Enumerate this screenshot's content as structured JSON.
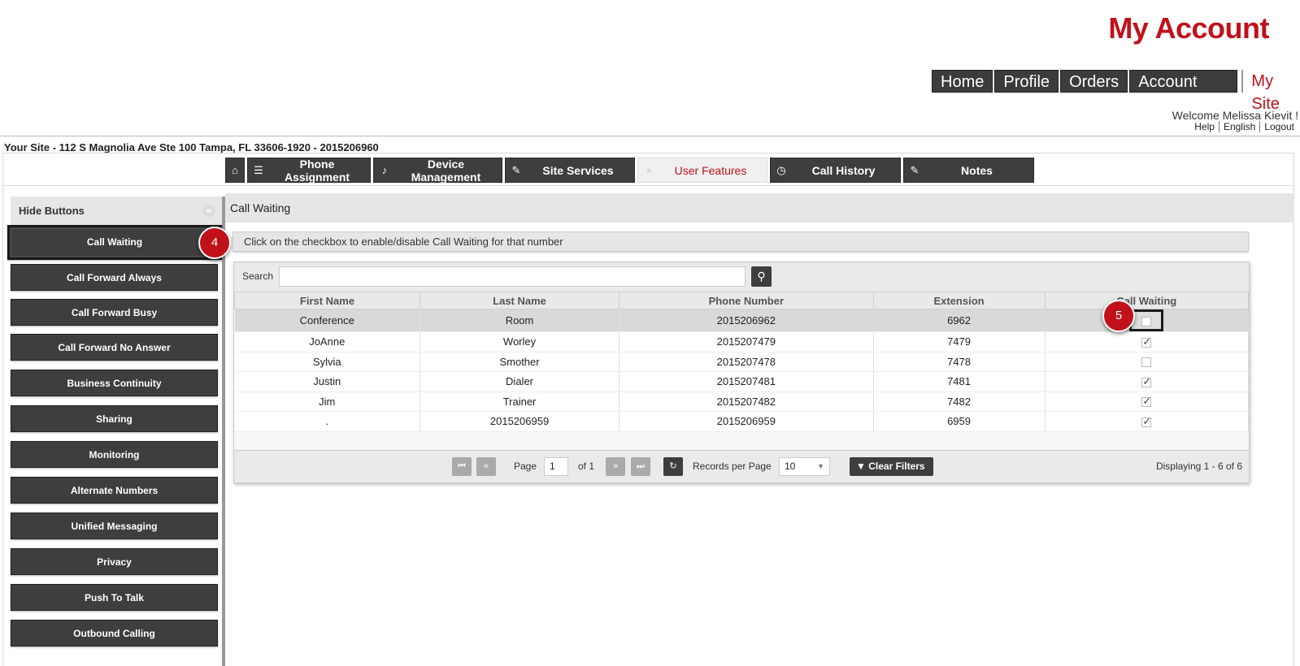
{
  "header": {
    "brand": "My Account",
    "nav": [
      "Home",
      "Profile",
      "Orders",
      "Account Admin"
    ],
    "nav_active": "My Site",
    "welcome": "Welcome Melissa Kievit !",
    "links": [
      "Help",
      "English",
      "Logout"
    ]
  },
  "site": {
    "title": "Your Site - 112 S Magnolia Ave Ste 100 Tampa, FL 33606-1920 - 2015206960"
  },
  "tabs": [
    {
      "label": "",
      "icon": "home-icon",
      "glyph": "⌂"
    },
    {
      "label": "Phone Assignment",
      "icon": "list-icon",
      "glyph": "☰"
    },
    {
      "label": "Device Management",
      "icon": "bell-icon",
      "glyph": "♪"
    },
    {
      "label": "Site Services",
      "icon": "edit-icon",
      "glyph": "✎"
    },
    {
      "label": "User Features",
      "icon": "user-icon",
      "glyph": "●"
    },
    {
      "label": "Call History",
      "icon": "clock-icon",
      "glyph": "◷"
    },
    {
      "label": "Notes",
      "icon": "pencil-icon",
      "glyph": "✎"
    }
  ],
  "sidebar": {
    "head": "Hide Buttons",
    "collapse_glyph": "«",
    "items": [
      "Call Waiting",
      "Call Forward Always",
      "Call Forward Busy",
      "Call Forward No Answer",
      "Business Continuity",
      "Sharing",
      "Monitoring",
      "Alternate Numbers",
      "Unified Messaging",
      "Privacy",
      "Push To Talk",
      "Outbound Calling"
    ]
  },
  "steps": [
    "4",
    "5"
  ],
  "main": {
    "title": "Call Waiting",
    "hint": "Click on the checkbox to enable/disable Call Waiting for that number",
    "search_label": "Search",
    "search_value": "",
    "search_glyph": "⚲",
    "columns": [
      "First Name",
      "Last Name",
      "Phone Number",
      "Extension",
      "Call Waiting"
    ],
    "rows": [
      {
        "first": "Conference",
        "last": "Room",
        "phone": "2015206962",
        "ext": "6962",
        "cw": false
      },
      {
        "first": "JoAnne",
        "last": "Worley",
        "phone": "2015207479",
        "ext": "7479",
        "cw": true
      },
      {
        "first": "Sylvia",
        "last": "Smother",
        "phone": "2015207478",
        "ext": "7478",
        "cw": false
      },
      {
        "first": "Justin",
        "last": "Dialer",
        "phone": "2015207481",
        "ext": "7481",
        "cw": true
      },
      {
        "first": "Jim",
        "last": "Trainer",
        "phone": "2015207482",
        "ext": "7482",
        "cw": true
      },
      {
        "first": ".",
        "last": "2015206959",
        "phone": "2015206959",
        "ext": "6959",
        "cw": true
      }
    ]
  },
  "pager": {
    "page_label": "Page",
    "page_value": "1",
    "of_label": "of 1",
    "records_label": "Records per Page",
    "records_value": "10",
    "clear_label": "Clear Filters",
    "displaying": "Displaying 1 - 6 of 6",
    "glyphs": {
      "first": "⏮",
      "prev": "«",
      "next": "»",
      "last": "⏭",
      "refresh": "↻",
      "filter": "▼",
      "dropdown": "▼"
    }
  }
}
